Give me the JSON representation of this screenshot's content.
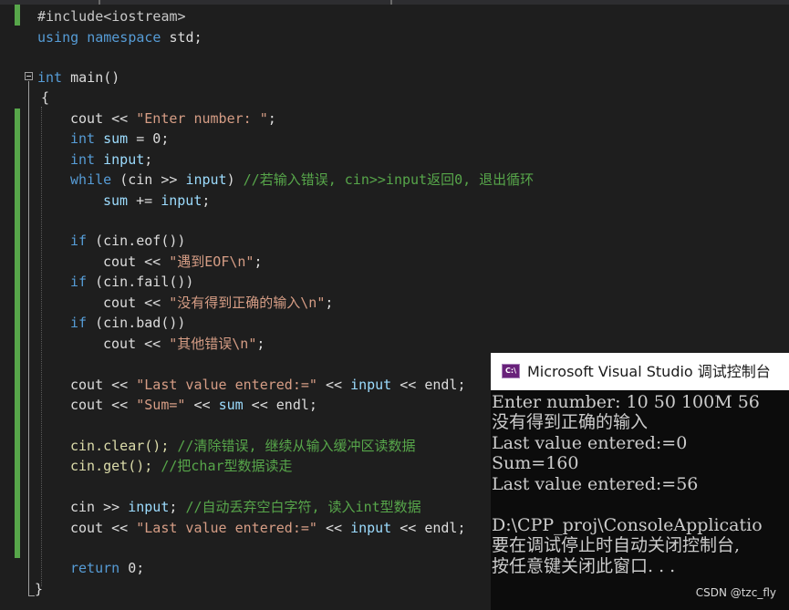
{
  "editor": {
    "lines": {
      "l1": "#include<iostream>",
      "l2_kw1": "using",
      "l2_kw2": "namespace",
      "l2_rest": "std;",
      "l4_kw": "int",
      "l4_rest": "main()",
      "l5": "{",
      "l6_a": "cout << ",
      "l6_str": "\"Enter number: \"",
      "l6_b": ";",
      "l7_kw": "int",
      "l7_var": "sum",
      "l7_rest": "= 0;",
      "l8_kw": "int",
      "l8_var": "input",
      "l8_rest": ";",
      "l9_kw": "while",
      "l9_a": "(cin >> ",
      "l9_var": "input",
      "l9_b": ")",
      "l9_cmt": "//若输入错误, cin>>input返回0, 退出循环",
      "l10_var1": "sum",
      "l10_a": "+=",
      "l10_var2": "input",
      "l10_b": ";",
      "l12_kw": "if",
      "l12_rest": "(cin.eof())",
      "l13_a": "cout << ",
      "l13_str": "\"遇到EOF\\n\"",
      "l13_b": ";",
      "l14_kw": "if",
      "l14_rest": "(cin.fail())",
      "l15_a": "cout << ",
      "l15_str": "\"没有得到正确的输入\\n\"",
      "l15_b": ";",
      "l16_kw": "if",
      "l16_rest": "(cin.bad())",
      "l17_a": "cout << ",
      "l17_str": "\"其他错误\\n\"",
      "l17_b": ";",
      "l19_a": "cout << ",
      "l19_str": "\"Last value entered:=\"",
      "l19_b": " << ",
      "l19_var": "input",
      "l19_c": " << endl;",
      "l20_a": "cout << ",
      "l20_str": "\"Sum=\"",
      "l20_b": " << ",
      "l20_var": "sum",
      "l20_c": " << endl;",
      "l22_a": "cin.clear();",
      "l22_cmt": "//清除错误, 继续从输入缓冲区读数据",
      "l23_a": "cin.get();",
      "l23_cmt": "//把char型数据读走",
      "l25_a": "cin >> ",
      "l25_var": "input",
      "l25_b": ";",
      "l25_cmt": "//自动丢弃空白字符, 读入int型数据",
      "l26_a": "cout << ",
      "l26_str": "\"Last value entered:=\"",
      "l26_b": " << ",
      "l26_var": "input",
      "l26_c": " << endl;",
      "l28_kw": "return",
      "l28_rest": "0;",
      "l29": "}"
    }
  },
  "console": {
    "icon_label": "C:\\",
    "title": "Microsoft Visual Studio 调试控制台",
    "output": [
      "Enter number: 10 50 100M 56",
      "没有得到正确的输入",
      "Last value entered:=0",
      "Sum=160",
      "Last value entered:=56",
      "",
      "D:\\CPP_proj\\ConsoleApplicatio",
      "要在调试停止时自动关闭控制台,",
      "按任意键关闭此窗口. . ."
    ]
  },
  "watermark": "CSDN @tzc_fly",
  "colors": {
    "background": "#1e1e1e",
    "keyword": "#569cd6",
    "string": "#d69d85",
    "comment": "#57a64a",
    "variable": "#9cdcfe",
    "change_bar": "#57a64a"
  }
}
